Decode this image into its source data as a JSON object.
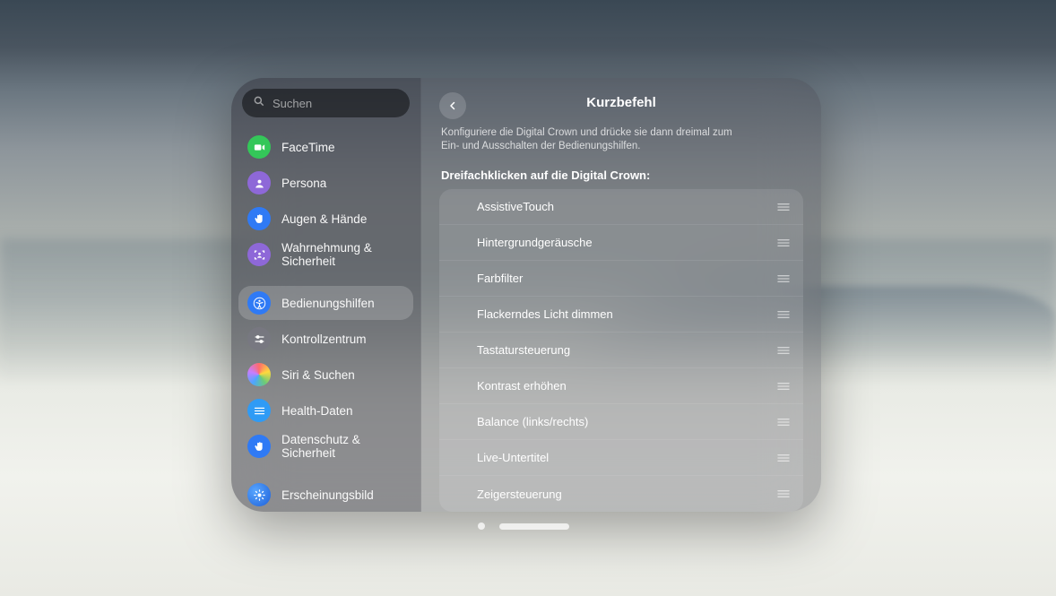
{
  "search": {
    "placeholder": "Suchen"
  },
  "sidebar": {
    "items": [
      {
        "label": "FaceTime"
      },
      {
        "label": "Persona"
      },
      {
        "label": "Augen & Hände"
      },
      {
        "label": "Wahrnehmung & Sicherheit"
      },
      {
        "label": "Bedienungshilfen"
      },
      {
        "label": "Kontrollzentrum"
      },
      {
        "label": "Siri & Suchen"
      },
      {
        "label": "Health-Daten"
      },
      {
        "label": "Datenschutz & Sicherheit"
      },
      {
        "label": "Erscheinungsbild"
      }
    ]
  },
  "main": {
    "title": "Kurzbefehl",
    "subtitle": "Konfiguriere die Digital Crown und drücke sie dann dreimal zum Ein- und Ausschalten der Bedienungshilfen.",
    "section": "Dreifachklicken auf die Digital Crown:",
    "options": [
      "AssistiveTouch",
      "Hintergrundgeräusche",
      "Farbfilter",
      "Flackerndes Licht dimmen",
      "Tastatursteuerung",
      "Kontrast erhöhen",
      "Balance (links/rechts)",
      "Live-Untertitel",
      "Zeigersteuerung"
    ]
  }
}
